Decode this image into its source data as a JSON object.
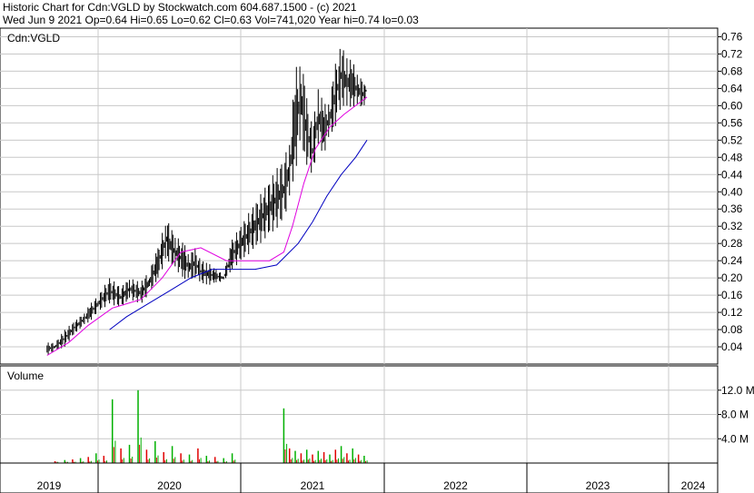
{
  "header": {
    "line1": "Historic Chart for Cdn:VGLD by Stockwatch.com 604.687.1500 - (c) 2021",
    "line2": "Wed Jun  9 2021  Op=0.64  Hi=0.65  Lo=0.62  Cl=0.63  Vol=741,020  Year hi=0.74  lo=0.03"
  },
  "chart_data": [
    {
      "type": "line",
      "panel": "price",
      "title": "Cdn:VGLD",
      "ylim": [
        0,
        0.78
      ],
      "yticks": [
        "0.04",
        "0.08",
        "0.12",
        "0.16",
        "0.20",
        "0.24",
        "0.28",
        "0.32",
        "0.36",
        "0.40",
        "0.44",
        "0.48",
        "0.52",
        "0.56",
        "0.60",
        "0.64",
        "0.68",
        "0.72",
        "0.76"
      ],
      "grid": true,
      "price_colors": {
        "bars": "#000000",
        "ma_short": "#e000e0",
        "ma_long": "#0000c0"
      },
      "series": [
        {
          "role": "price-high-low",
          "t": [
            0.48,
            0.56,
            0.66,
            0.76,
            0.86,
            0.92,
            1.0,
            1.08,
            1.16,
            1.22,
            1.3,
            1.36,
            1.42,
            1.48,
            1.54,
            1.6,
            1.64,
            1.68,
            1.72,
            1.76,
            1.82,
            1.88,
            1.94,
            2.3,
            2.34,
            2.38,
            2.42,
            2.46,
            2.5,
            2.54,
            2.58,
            2.62,
            2.66,
            2.7,
            2.74,
            2.78,
            2.82,
            2.86,
            2.88
          ],
          "high": [
            0.05,
            0.05,
            0.08,
            0.1,
            0.12,
            0.14,
            0.16,
            0.2,
            0.18,
            0.2,
            0.19,
            0.22,
            0.27,
            0.34,
            0.3,
            0.28,
            0.26,
            0.27,
            0.24,
            0.24,
            0.22,
            0.21,
            0.29,
            0.48,
            0.52,
            0.68,
            0.73,
            0.62,
            0.55,
            0.65,
            0.6,
            0.62,
            0.7,
            0.74,
            0.72,
            0.7,
            0.68,
            0.65,
            0.66
          ],
          "low": [
            0.02,
            0.03,
            0.04,
            0.07,
            0.09,
            0.1,
            0.12,
            0.14,
            0.13,
            0.15,
            0.14,
            0.16,
            0.2,
            0.24,
            0.22,
            0.2,
            0.19,
            0.2,
            0.19,
            0.18,
            0.19,
            0.19,
            0.22,
            0.33,
            0.38,
            0.45,
            0.5,
            0.46,
            0.44,
            0.5,
            0.49,
            0.52,
            0.55,
            0.6,
            0.59,
            0.6,
            0.59,
            0.6,
            0.62
          ]
        },
        {
          "role": "ma-short",
          "t": [
            0.48,
            0.7,
            0.9,
            1.1,
            1.3,
            1.45,
            1.58,
            1.72,
            1.9,
            2.0,
            2.2,
            2.3,
            2.36,
            2.44,
            2.52,
            2.62,
            2.72,
            2.8,
            2.88
          ],
          "y": [
            0.02,
            0.05,
            0.09,
            0.13,
            0.15,
            0.2,
            0.26,
            0.27,
            0.24,
            0.24,
            0.24,
            0.26,
            0.32,
            0.42,
            0.5,
            0.55,
            0.58,
            0.6,
            0.62
          ]
        },
        {
          "role": "ma-long",
          "t": [
            1.08,
            1.2,
            1.35,
            1.5,
            1.65,
            1.8,
            1.95,
            2.1,
            2.25,
            2.4,
            2.5,
            2.6,
            2.7,
            2.8,
            2.88
          ],
          "y": [
            0.08,
            0.11,
            0.14,
            0.17,
            0.2,
            0.22,
            0.22,
            0.22,
            0.23,
            0.28,
            0.33,
            0.39,
            0.44,
            0.48,
            0.52
          ]
        }
      ]
    },
    {
      "type": "bar",
      "panel": "volume",
      "title": "Volume",
      "ylim": [
        0,
        16
      ],
      "yticks": [
        "4.0 M",
        "8.0 M",
        "12.0 M"
      ],
      "grid": true,
      "colors": {
        "up": "#00b000",
        "down": "#e00000"
      },
      "t": [
        0.56,
        0.66,
        0.74,
        0.82,
        0.9,
        0.98,
        1.04,
        1.1,
        1.16,
        1.22,
        1.28,
        1.34,
        1.4,
        1.46,
        1.52,
        1.58,
        1.64,
        1.7,
        1.76,
        1.82,
        1.88,
        1.94,
        2.3,
        2.34,
        2.38,
        2.42,
        2.46,
        2.5,
        2.54,
        2.58,
        2.62,
        2.66,
        2.7,
        2.74,
        2.78,
        2.82,
        2.86
      ],
      "values": [
        0.3,
        0.5,
        0.6,
        0.8,
        1.0,
        1.6,
        1.2,
        10.5,
        2.4,
        3.0,
        12.0,
        2.2,
        3.6,
        1.8,
        2.8,
        1.6,
        1.4,
        2.4,
        1.2,
        1.0,
        0.8,
        1.6,
        9.0,
        2.4,
        2.0,
        1.6,
        2.2,
        1.4,
        2.0,
        1.8,
        1.4,
        2.2,
        2.8,
        1.6,
        2.4,
        1.4,
        1.2
      ],
      "up": [
        false,
        true,
        false,
        true,
        false,
        true,
        false,
        true,
        false,
        true,
        true,
        false,
        true,
        false,
        true,
        false,
        true,
        false,
        true,
        false,
        true,
        true,
        true,
        false,
        true,
        false,
        true,
        false,
        true,
        false,
        true,
        false,
        true,
        false,
        true,
        false,
        true
      ]
    }
  ],
  "time_axis": {
    "years": [
      "2019",
      "2020",
      "2021",
      "2022",
      "2023",
      "2024"
    ],
    "start_year": 2019
  }
}
